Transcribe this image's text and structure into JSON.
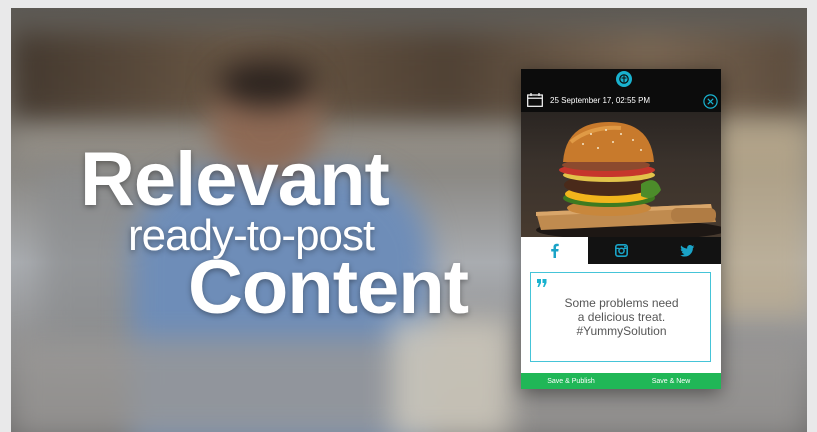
{
  "headline": {
    "line1": "Relevant",
    "line2": "ready-to-post",
    "line3": "Content"
  },
  "card": {
    "date": "25 September 17, 02:55 PM",
    "post_lines": [
      "Some problems need",
      "a delicious treat.",
      "#YummySolution"
    ],
    "tabs": [
      {
        "icon": "facebook-icon",
        "active": true
      },
      {
        "icon": "instagram-icon",
        "active": false
      },
      {
        "icon": "twitter-icon",
        "active": false
      }
    ],
    "buttons": {
      "save_publish": "Save & Publish",
      "save_new": "Save & New"
    },
    "colors": {
      "accent": "#19b2cf",
      "facebook": "#1aa3c7",
      "bar": "#20b757"
    }
  }
}
